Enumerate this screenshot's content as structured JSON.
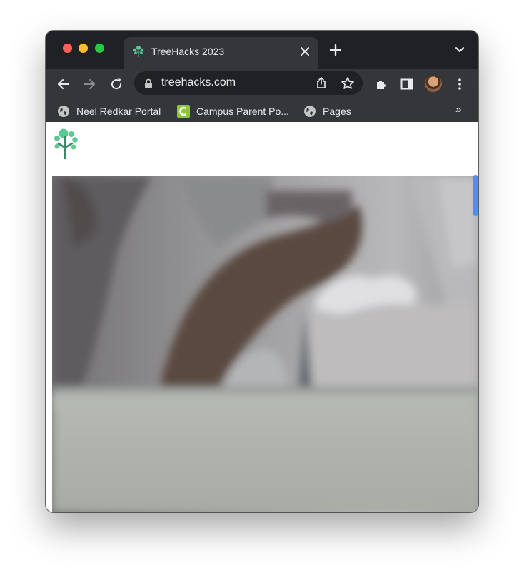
{
  "tab": {
    "title": "TreeHacks 2023"
  },
  "omnibox": {
    "url": "treehacks.com"
  },
  "bookmarks": {
    "items": [
      {
        "label": "Neel Redkar Portal",
        "icon": "globe-icon"
      },
      {
        "label": "Campus Parent Po...",
        "icon": "campus-c-icon"
      },
      {
        "label": "Pages",
        "icon": "globe-icon"
      }
    ],
    "overflow": "»"
  },
  "colors": {
    "tabstrip": "#202124",
    "toolbar": "#35363a",
    "accent_scroll": "#4f8ef7",
    "logo_green": "#5ec794",
    "campus_icon": "#8cc63f"
  }
}
